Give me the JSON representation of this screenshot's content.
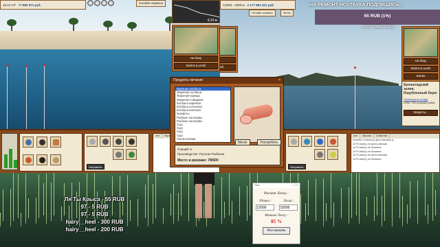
{
  "left_game": {
    "status": {
      "time": "16:10 СР",
      "balance": "77 880 971 руб."
    },
    "top_buttons": {
      "online": "Онлайн сервисы",
      "menu": "Меню"
    },
    "depth": "4,34 м",
    "map_buttons": {
      "to_base": "На базу",
      "to_hq": "Войти в штаб"
    },
    "repair_button": "Натравить",
    "chat_tabs": [
      "чат",
      "Игроки",
      "Событие"
    ]
  },
  "right_game": {
    "status": {
      "time": "С2000 - 4000 м",
      "balance": "2 177 882 421 руб."
    },
    "top_buttons": {
      "online": "Онлайн сервисы",
      "menu": "Меню"
    },
    "map_buttons": {
      "to_base": "На базу",
      "to_hq": "Войти в штаб",
      "baggage": "Багаж"
    },
    "info_panel": {
      "title": "Кронштадский залив. Изрубленный берег",
      "link": "Посмотреть погоду",
      "text": "Клёв: 100 (сорная рыба)",
      "requests": "Запреты..."
    },
    "chat_tabs": [
      "чат",
      "Игроки",
      "Событие"
    ],
    "chat_lines": [
      "Sardina 2 Imkwr(с) фото мелкая р...",
      "1л79 сwrl(с) ло фото мелкая",
      "1л79 сwrl(с) ло боковое",
      "1л79 сwrl(с) ло боковое",
      "1л79 сwrl(с) ло фото мелкая",
      "1л79 сwrl(с) ло боковое"
    ],
    "repair_button": "Натравить"
  },
  "overlay": {
    "news_title": "НА РЕМОНТ НОУТБУКА ПОДПИШИСЬ...",
    "sber_amount": "65 RUB (1%)",
    "sber_caption": "СБОР ЗАВЕРШЁН"
  },
  "dialog": {
    "title": "Продукты питания",
    "close": "×",
    "items": [
      "Варёная колбаса",
      "Жареная колбаса",
      "Жареная курица",
      "Жареная говядина",
      "Колбаса варёная",
      "Колбаса копчёная",
      "Колбаса вяленая",
      "Конфеты",
      "Рыбные консервы",
      "Рыбные консервы",
      "Сыр",
      "Сыр",
      "Сыр",
      "Сыр",
      "Уха Бочковая"
    ],
    "selected_index": 0,
    "menu_button": "Меню",
    "use_button": "Употребить",
    "portions": "Порций: 6",
    "producer": "Производство: Русская Рыбалка",
    "capacity": "Место в рюкзаке: 78/500"
  },
  "donations": [
    "Ля Ты Крыса - 55 RUB",
    "97 - 5 RUB",
    "97 - 5 RUB",
    "hairy__heel - 300 RUB",
    "hairy__heel - 200 RUB"
  ],
  "calculator": {
    "window_title": "Лол",
    "controls": "— □ ×",
    "heading": "Расчет Лески :",
    "label_udochka": "Удочка :",
    "label_leska": "Леска :",
    "input_udochka": "12000",
    "input_leska": "15000",
    "label_result": "Меньше Леску :",
    "result": "85 %",
    "button": "Рассчитать"
  },
  "colors": {
    "wood": "#a85a20",
    "accent_red": "#d21c1c",
    "selection": "#3267c8"
  }
}
